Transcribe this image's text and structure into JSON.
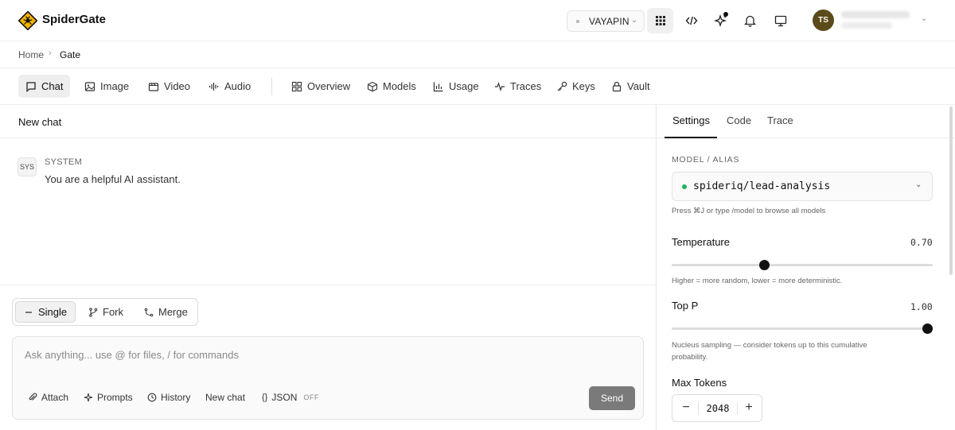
{
  "app": {
    "name": "SpiderGate"
  },
  "topbar": {
    "org": "VAYAPIN",
    "user_initials": "TS"
  },
  "breadcrumb": {
    "home": "Home",
    "current": "Gate"
  },
  "tabs": [
    {
      "label": "Chat",
      "icon": "chat-bubble-icon",
      "active": true
    },
    {
      "label": "Image",
      "icon": "image-icon"
    },
    {
      "label": "Video",
      "icon": "video-icon"
    },
    {
      "label": "Audio",
      "icon": "audio-wave-icon"
    },
    {
      "label": "Overview",
      "icon": "grid-icon"
    },
    {
      "label": "Models",
      "icon": "cube-icon"
    },
    {
      "label": "Usage",
      "icon": "bar-chart-icon"
    },
    {
      "label": "Traces",
      "icon": "pulse-icon"
    },
    {
      "label": "Keys",
      "icon": "key-icon"
    },
    {
      "label": "Vault",
      "icon": "lock-icon"
    }
  ],
  "chat": {
    "title": "New chat",
    "system_badge": "SYS",
    "system_role": "SYSTEM",
    "system_message": "You are a helpful AI assistant."
  },
  "modes": {
    "single": "Single",
    "fork": "Fork",
    "merge": "Merge",
    "selected": "Single"
  },
  "composer": {
    "placeholder": "Ask anything... use @ for files, / for commands",
    "attach": "Attach",
    "prompts": "Prompts",
    "history": "History",
    "new_chat": "New chat",
    "json": "JSON",
    "json_state": "OFF",
    "send": "Send"
  },
  "settings": {
    "tabs": {
      "settings": "Settings",
      "code": "Code",
      "trace": "Trace"
    },
    "model_label": "MODEL / ALIAS",
    "model": "spideriq/lead-analysis",
    "model_status_color": "#1fb35a",
    "model_hint": "Press ⌘J or type /model to browse all models",
    "temperature": {
      "label": "Temperature",
      "value": "0.70",
      "fraction": 0.35,
      "hint": "Higher = more random, lower = more deterministic."
    },
    "top_p": {
      "label": "Top P",
      "value": "1.00",
      "fraction": 1.0,
      "hint_line1": "Nucleus sampling — consider tokens up to this cumulative",
      "hint_line2": "probability."
    },
    "max_tokens": {
      "label": "Max Tokens",
      "value": "2048"
    }
  }
}
